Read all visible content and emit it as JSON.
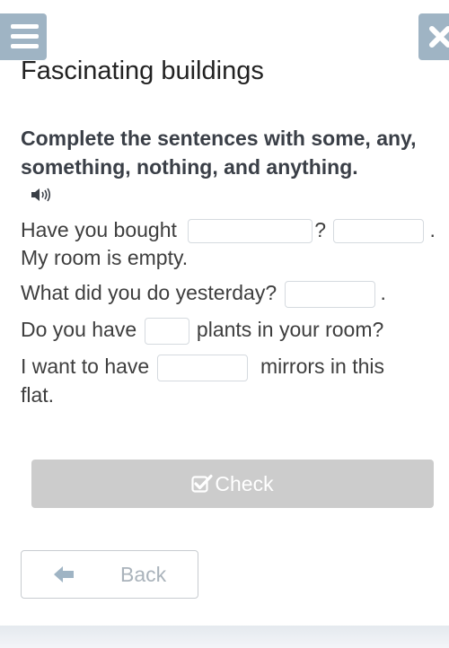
{
  "header": {
    "menu_icon": "hamburger-menu-icon",
    "close_icon": "close-icon",
    "title": "Fascinating buildings"
  },
  "exercise": {
    "instruction": "Complete the sentences with some, any, something, nothing, and anything.",
    "audio_icon": "speaker-icon",
    "sentences": [
      {
        "parts": [
          "Have you bought",
          "?",
          "."
        ],
        "gaps": [
          "",
          ""
        ]
      },
      {
        "parts": [
          "My room is empty."
        ]
      },
      {
        "parts": [
          "What did you do yesterday?",
          "."
        ],
        "gaps": [
          ""
        ]
      },
      {
        "parts": [
          "Do you have",
          "plants in your room?"
        ],
        "gaps": [
          ""
        ]
      },
      {
        "parts": [
          "I want to have",
          "mirrors in this",
          "flat."
        ],
        "gaps": [
          ""
        ]
      }
    ]
  },
  "actions": {
    "check_label": "Check",
    "check_icon": "checkbox-check-icon",
    "back_label": "Back",
    "back_icon": "arrow-left-icon"
  },
  "colors": {
    "top_button": "#9fb4c4",
    "check_button_disabled": "#cccccc",
    "back_text": "#aab3bb"
  }
}
